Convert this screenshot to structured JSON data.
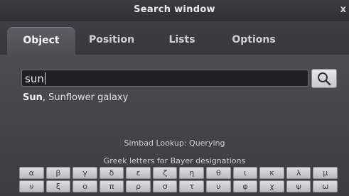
{
  "window": {
    "title": "Search window",
    "close_glyph": "x"
  },
  "tabs": [
    {
      "label": "Object",
      "active": true
    },
    {
      "label": "Position",
      "active": false
    },
    {
      "label": "Lists",
      "active": false
    },
    {
      "label": "Options",
      "active": false
    }
  ],
  "search": {
    "value": "sun",
    "button_icon": "search-icon"
  },
  "results": {
    "match_bold": "Sun",
    "rest": ", Sunflower galaxy"
  },
  "status_text": "Simbad Lookup: Querying",
  "greek": {
    "title": "Greek letters for Bayer designations",
    "row1": [
      "α",
      "β",
      "γ",
      "δ",
      "ε",
      "ζ",
      "η",
      "θ",
      "ι",
      "κ",
      "λ",
      "μ"
    ],
    "row2": [
      "ν",
      "ξ",
      "ο",
      "π",
      "ρ",
      "σ",
      "τ",
      "υ",
      "φ",
      "χ",
      "ψ",
      "ω"
    ]
  },
  "colors": {
    "window_bg": "#3b3e43",
    "input_bg": "#1e2023",
    "key_bg": "#c9cdd1",
    "text": "#dfe2e5"
  }
}
